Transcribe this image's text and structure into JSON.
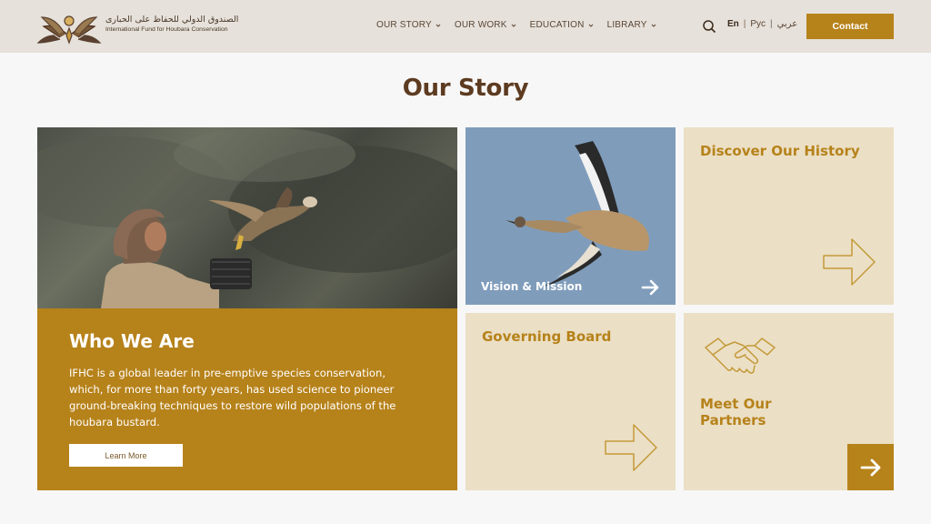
{
  "header": {
    "logo_ar": "الصندوق الدولي للحفاظ على الحبارى",
    "logo_en": "International Fund for Houbara Conservation",
    "nav": [
      {
        "label": "OUR STORY"
      },
      {
        "label": "OUR WORK"
      },
      {
        "label": "EDUCATION"
      },
      {
        "label": "LIBRARY"
      }
    ],
    "lang": {
      "en": "En",
      "ru": "Рус",
      "ar": "عربي"
    },
    "contact_label": "Contact"
  },
  "page": {
    "title": "Our Story"
  },
  "tiles": {
    "who": {
      "title": "Who We Are",
      "text": "IFHC is a global leader in pre-emptive species conservation, which, for more than forty years, has used science to pioneer ground-breaking techniques to restore wild populations of the houbara bustard.",
      "button": "Learn More"
    },
    "vision": {
      "label": "Vision & Mission"
    },
    "history": {
      "title": "Discover Our History"
    },
    "board": {
      "title": "Governing Board"
    },
    "partners": {
      "title": "Meet Our Partners"
    }
  },
  "colors": {
    "accent": "#b6821a",
    "beige": "#ebdfc5",
    "header_bg": "#e6e1da",
    "title": "#5d3b20"
  },
  "icons": [
    "logo-emblem",
    "chevron-down-icon",
    "search-icon",
    "arrow-right-icon",
    "outline-arrow-icon",
    "handshake-icon"
  ]
}
